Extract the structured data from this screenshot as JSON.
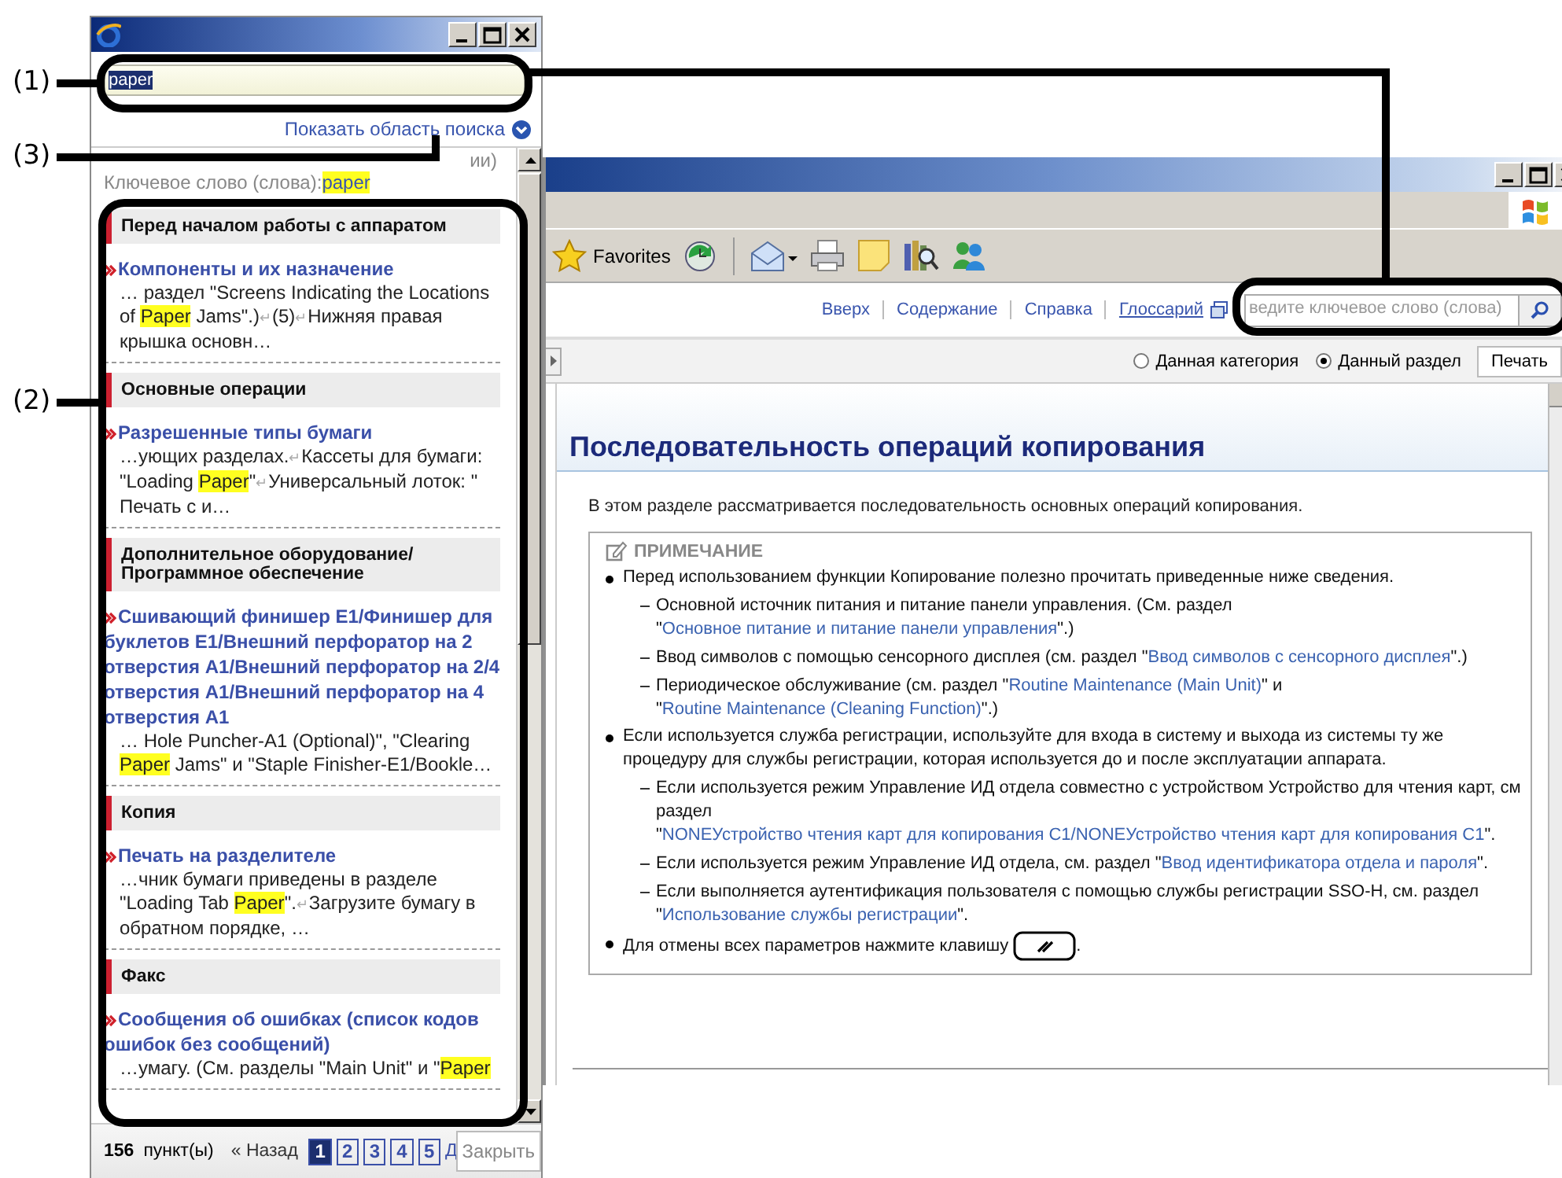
{
  "callouts": [
    {
      "label": "(1)"
    },
    {
      "label": "(3)"
    },
    {
      "label": "(2)"
    }
  ],
  "help_window": {
    "search": {
      "value": "paper",
      "text_selected": true
    },
    "show_search_area": "Показать область поиска",
    "scope_tail": "ии)",
    "keyword": {
      "label": "Ключевое слово (слова):",
      "value": "paper"
    },
    "results": [
      {
        "category": "Перед началом работы с аппаратом",
        "items": [
          {
            "title": "Компоненты и их назначение",
            "snippet": [
              {
                "kind": "text",
                "text": "… раздел \"Screens Indicating the Locations of "
              },
              {
                "kind": "highlight",
                "text": "Paper"
              },
              {
                "kind": "text",
                "text": " Jams\".)"
              },
              {
                "kind": "return",
                "text": "↵"
              },
              {
                "kind": "text",
                "text": "(5)"
              },
              {
                "kind": "return",
                "text": "↵"
              },
              {
                "kind": "text",
                "text": "Нижняя правая крышка основн…"
              }
            ]
          }
        ]
      },
      {
        "category": "Основные операции",
        "items": [
          {
            "title": "Разрешенные типы бумаги",
            "snippet": [
              {
                "kind": "text",
                "text": "…ующих разделах."
              },
              {
                "kind": "return",
                "text": "↵"
              },
              {
                "kind": "text",
                "text": "Кассеты для бумаги: \"Loading "
              },
              {
                "kind": "highlight",
                "text": "Paper"
              },
              {
                "kind": "text",
                "text": "\""
              },
              {
                "kind": "return",
                "text": "↵"
              },
              {
                "kind": "text",
                "text": "Универсальный лоток: \" Печать с и…"
              }
            ]
          }
        ]
      },
      {
        "category": "Дополнительное оборудование/Программное обеспечение",
        "items": [
          {
            "title": "Сшивающий финишер E1/Финишер для буклетов E1/Внешний перфоратор на 2 отверстия A1/Внешний перфоратор на 2/4 отверстия A1/Внешний перфоратор на 4 отверстия A1",
            "snippet": [
              {
                "kind": "text",
                "text": "… Hole Puncher-A1 (Optional)\", \"Clearing "
              },
              {
                "kind": "highlight",
                "text": "Paper"
              },
              {
                "kind": "text",
                "text": " Jams\" и \"Staple Finisher-E1/Bookle…"
              }
            ]
          }
        ]
      },
      {
        "category": "Копия",
        "items": [
          {
            "title": "Печать на разделителе",
            "snippet": [
              {
                "kind": "text",
                "text": "…чник бумаги приведены в разделе \"Loading Tab "
              },
              {
                "kind": "highlight",
                "text": "Paper"
              },
              {
                "kind": "text",
                "text": "\"."
              },
              {
                "kind": "return",
                "text": "↵"
              },
              {
                "kind": "text",
                "text": "Загрузите бумагу в обратном порядке, …"
              }
            ]
          }
        ]
      },
      {
        "category": "Факс",
        "items": [
          {
            "title": "Сообщения об ошибках (список кодов ошибок без сообщений)",
            "snippet": [
              {
                "kind": "text",
                "text": "…умагу. (См. разделы \"Main Unit\" и \""
              },
              {
                "kind": "highlight",
                "text": "Paper"
              }
            ]
          }
        ]
      }
    ],
    "footer": {
      "count": "156",
      "count_label": "пункт(ы)",
      "back": "« Назад",
      "pages": [
        {
          "label": "1",
          "selected": true
        },
        {
          "label": "2",
          "selected": false
        },
        {
          "label": "3",
          "selected": false
        },
        {
          "label": "4",
          "selected": false
        },
        {
          "label": "5",
          "selected": false
        }
      ],
      "next": "Д",
      "close": "Закрыть"
    }
  },
  "browser": {
    "favorites": "Favorites",
    "nav_links": [
      {
        "label": "Вверх",
        "hovered": false,
        "external": false
      },
      {
        "label": "Содержание",
        "hovered": false,
        "external": false
      },
      {
        "label": "Справка",
        "hovered": false,
        "external": false
      },
      {
        "label": "Глоссарий",
        "hovered": true,
        "external": true
      }
    ],
    "search_placeholder": "ведите ключевое слово (слова)",
    "scope": [
      {
        "label": "Данная категория",
        "selected": false
      },
      {
        "label": "Данный раздел",
        "selected": true
      }
    ],
    "print": "Печать",
    "heading": "Последовательность операций копирования",
    "intro": "В этом разделе рассматривается последовательность основных операций копирования.",
    "note": {
      "title": "ПРИМЕЧАНИЕ",
      "bullets": [
        {
          "parts": [
            {
              "kind": "text",
              "text": "Перед использованием функции Копирование полезно прочитать приведенные ниже сведения."
            }
          ],
          "children": [
            {
              "parts": [
                {
                  "kind": "text",
                  "text": "Основной источник питания и питание панели управления. (См. раздел \""
                },
                {
                  "kind": "link",
                  "text": "Основное питание и питание панели управления"
                },
                {
                  "kind": "text",
                  "text": "\".)"
                }
              ]
            },
            {
              "parts": [
                {
                  "kind": "text",
                  "text": "Ввод символов с помощью сенсорного дисплея (см. раздел \""
                },
                {
                  "kind": "link",
                  "text": "Ввод символов с сенсорного дисплея"
                },
                {
                  "kind": "text",
                  "text": "\".)"
                }
              ]
            },
            {
              "parts": [
                {
                  "kind": "text",
                  "text": "Периодическое обслуживание (см. раздел \""
                },
                {
                  "kind": "link",
                  "text": "Routine Maintenance (Main Unit)"
                },
                {
                  "kind": "text",
                  "text": "\" и \""
                },
                {
                  "kind": "link",
                  "text": "Routine Maintenance (Cleaning Function)"
                },
                {
                  "kind": "text",
                  "text": "\".)"
                }
              ]
            }
          ]
        },
        {
          "parts": [
            {
              "kind": "text",
              "text": "Если используется служба регистрации, используйте для входа в систему и выхода из системы ту же процедуру для службы регистрации, которая используется до и после эксплуатации аппарата."
            }
          ],
          "children": [
            {
              "parts": [
                {
                  "kind": "text",
                  "text": "Если используется режим Управление ИД отдела совместно с устройством Устройство для чтения карт, см раздел \""
                },
                {
                  "kind": "link",
                  "text": "NONEУстройство чтения карт для копирования C1/NONEУстройство чтения карт для копирования C1"
                },
                {
                  "kind": "text",
                  "text": "\"."
                }
              ]
            },
            {
              "parts": [
                {
                  "kind": "text",
                  "text": "Если используется режим Управление ИД отдела, см. раздел \""
                },
                {
                  "kind": "link",
                  "text": "Ввод идентификатора отдела и пароля"
                },
                {
                  "kind": "text",
                  "text": "\"."
                }
              ]
            },
            {
              "parts": [
                {
                  "kind": "text",
                  "text": "Если выполняется аутентификация пользователя с помощью службы регистрации SSO-H, см. раздел \""
                },
                {
                  "kind": "link",
                  "text": "Использование службы регистрации"
                },
                {
                  "kind": "text",
                  "text": "\"."
                }
              ]
            }
          ]
        },
        {
          "parts": [
            {
              "kind": "text",
              "text": "Для отмены всех параметров нажмите клавишу "
            },
            {
              "kind": "key"
            },
            {
              "kind": "text",
              "text": "."
            }
          ]
        }
      ]
    }
  }
}
